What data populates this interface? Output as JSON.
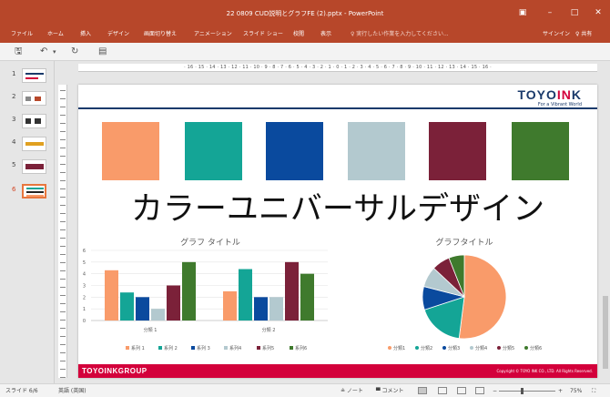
{
  "window": {
    "title": "22 0809 CUD説明とグラフFE (2).pptx - PowerPoint",
    "controls": [
      "▣",
      "–",
      "□",
      "✕"
    ]
  },
  "ribbon": {
    "tabs": [
      "ファイル",
      "ホーム",
      "挿入",
      "デザイン",
      "画面切り替え",
      "アニメーション",
      "スライド ショー",
      "校閲",
      "表示"
    ],
    "tell_me": "♀ 実行したい作業を入力してください...",
    "signin": "サインイン",
    "share": "♀ 共有"
  },
  "qat": {
    "save": "🖫",
    "undo": "↶",
    "undo_more": "▾",
    "redo": "↻",
    "present": "▤"
  },
  "thumbnails": {
    "numbers": [
      "1",
      "2",
      "3",
      "4",
      "5",
      "6"
    ],
    "active_index": 6
  },
  "ruler": {
    "horizontal": "· 16 · 15 · 14 · 13 · 12 · 11 · 10 · 9 · 8 · 7 · 6 · 5 · 4 · 3 · 2 · 1 · 0 · 1 · 2 · 3 · 4 · 5 · 6 · 7 · 8 · 9 · 10 · 11 · 12 · 13 · 14 · 15 · 16 ·"
  },
  "slide": {
    "logo_prefix": "TOYO",
    "logo_accent": "IN",
    "logo_suffix": "K",
    "logo_tagline": "For a Vibrant World",
    "swatch_colors": [
      "#f99b6a",
      "#14a596",
      "#0a4a9e",
      "#b3c9cf",
      "#7b2139",
      "#3f7a2d"
    ],
    "title": "カラーユニバーサルデザイン",
    "footer_left": "TOYOINKGROUP",
    "footer_right": "Copyright © TOYO INK CO., LTD. All Rights Reserved."
  },
  "chart_data": [
    {
      "type": "bar",
      "title": "グラフ タイトル",
      "categories": [
        "分類 1",
        "分類 2"
      ],
      "yticks": [
        "0",
        "1",
        "2",
        "3",
        "4",
        "5",
        "6"
      ],
      "ylim": [
        0,
        6
      ],
      "grid": true,
      "legend_position": "bottom",
      "series": [
        {
          "name": "系列 1",
          "color": "#f99b6a",
          "values": [
            4.3,
            2.5
          ]
        },
        {
          "name": "系列 2",
          "color": "#14a596",
          "values": [
            2.4,
            4.4
          ]
        },
        {
          "name": "系列 3",
          "color": "#0a4a9e",
          "values": [
            2.0,
            2.0
          ]
        },
        {
          "name": "系列4",
          "color": "#b3c9cf",
          "values": [
            1.0,
            2.0
          ]
        },
        {
          "name": "系列5",
          "color": "#7b2139",
          "values": [
            3.0,
            5.0
          ]
        },
        {
          "name": "系列6",
          "color": "#3f7a2d",
          "values": [
            5.0,
            4.0
          ]
        }
      ]
    },
    {
      "type": "pie",
      "title": "グラフタイトル",
      "legend_position": "bottom",
      "slices": [
        {
          "name": "分類1",
          "color": "#f99b6a",
          "value": 52
        },
        {
          "name": "分類2",
          "color": "#14a596",
          "value": 18
        },
        {
          "name": "分類3",
          "color": "#0a4a9e",
          "value": 9
        },
        {
          "name": "分類4",
          "color": "#b3c9cf",
          "value": 8
        },
        {
          "name": "分類5",
          "color": "#7b2139",
          "value": 7
        },
        {
          "name": "分類6",
          "color": "#3f7a2d",
          "value": 6
        }
      ]
    }
  ],
  "status": {
    "slide_info": "スライド 6/6",
    "language": "英語 (英国)",
    "notes": "≗ ノート",
    "comments": "▀ コメント",
    "zoom": "75%",
    "minus": "−",
    "plus": "+"
  }
}
